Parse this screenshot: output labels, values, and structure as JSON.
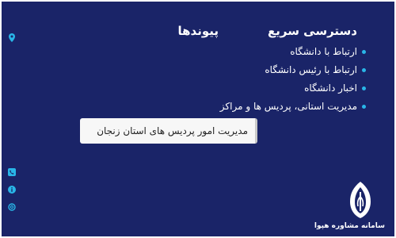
{
  "colors": {
    "background": "#1a2468",
    "accent": "#29b6e8",
    "text": "#ffffff"
  },
  "sections": {
    "quick_access": {
      "title": "دسترسی سریع",
      "items": [
        "ارتباط با دانشگاه",
        "ارتباط با رئیس دانشگاه",
        "اخبار دانشگاه",
        "مدیریت استانی، پردیس ها و مراکز"
      ]
    },
    "links": {
      "title": "پیوندها",
      "select": {
        "value": "مدیریت امور پردیس های استان زنجان"
      }
    }
  },
  "side_icons": [
    "location-icon",
    "phone-icon",
    "info-icon",
    "email-icon"
  ],
  "logo": {
    "text": "سامانه مشاوره هپوا"
  }
}
